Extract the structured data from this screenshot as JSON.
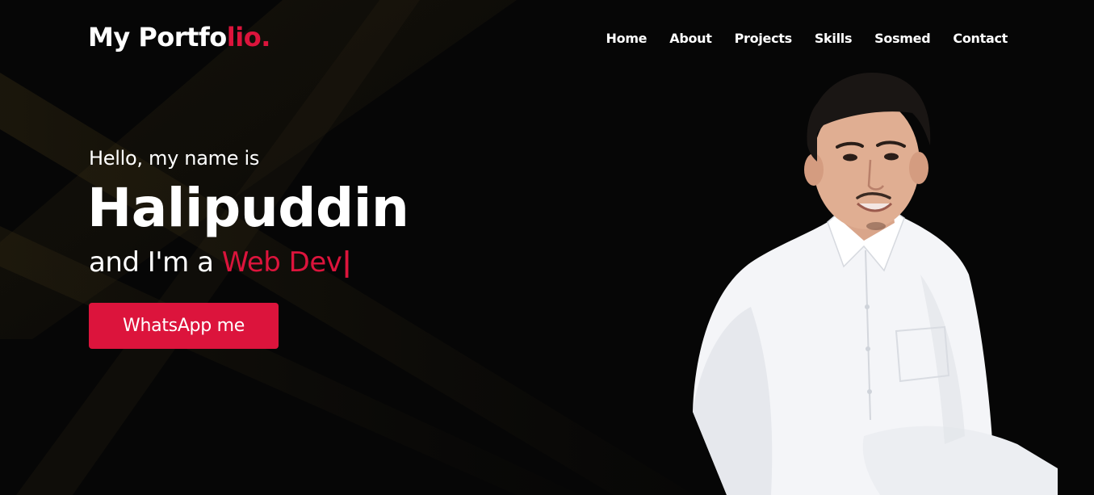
{
  "brand": {
    "logo_main": "My Portfo",
    "logo_accent": "lio."
  },
  "nav": {
    "items": [
      {
        "label": "Home"
      },
      {
        "label": "About"
      },
      {
        "label": "Projects"
      },
      {
        "label": "Skills"
      },
      {
        "label": "Sosmed"
      },
      {
        "label": "Contact"
      }
    ]
  },
  "hero": {
    "greeting": "Hello, my name is",
    "name": "Halipuddin",
    "role_prefix": "and I'm a",
    "role_highlight": "Web Dev",
    "cursor": "|",
    "cta_label": "WhatsApp me"
  },
  "colors": {
    "accent": "#dc143c",
    "background": "#050505",
    "text": "#ffffff"
  }
}
